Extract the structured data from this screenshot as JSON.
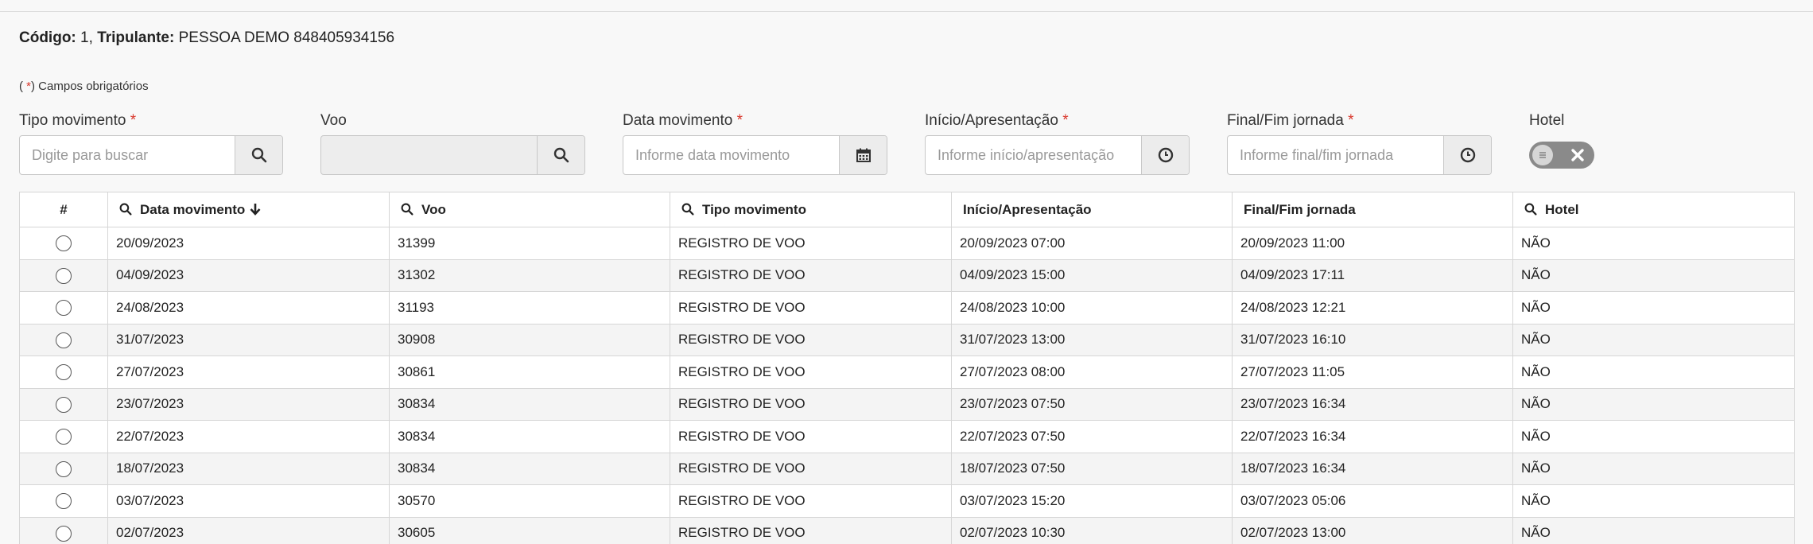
{
  "info": {
    "codigo_label": "Código:",
    "codigo_value": "1,",
    "tripulante_label": "Tripulante:",
    "tripulante_value": "PESSOA DEMO 848405934156"
  },
  "required_note": {
    "open": "(",
    "star": "*",
    "close": ") Campos obrigatórios"
  },
  "form": {
    "tipo_movimento": {
      "label": "Tipo movimento",
      "placeholder": "Digite para buscar",
      "required": "*",
      "button_icon": "search-icon"
    },
    "voo": {
      "label": "Voo",
      "placeholder": "",
      "button_icon": "search-icon"
    },
    "data_movimento": {
      "label": "Data movimento",
      "placeholder": "Informe data movimento",
      "required": "*",
      "button_icon": "calendar-icon"
    },
    "inicio": {
      "label": "Início/Apresentação",
      "placeholder": "Informe início/apresentação",
      "required": "*",
      "button_icon": "clock-icon"
    },
    "final": {
      "label": "Final/Fim jornada",
      "placeholder": "Informe final/fim jornada",
      "required": "*",
      "button_icon": "clock-icon"
    },
    "hotel": {
      "label": "Hotel",
      "state": "off"
    }
  },
  "table": {
    "headers": [
      "#",
      "Data movimento",
      "Voo",
      "Tipo movimento",
      "Início/Apresentação",
      "Final/Fim jornada",
      "Hotel"
    ],
    "rows": [
      [
        "20/09/2023",
        "31399",
        "REGISTRO DE VOO",
        "20/09/2023 07:00",
        "20/09/2023 11:00",
        "NÃO"
      ],
      [
        "04/09/2023",
        "31302",
        "REGISTRO DE VOO",
        "04/09/2023 15:00",
        "04/09/2023 17:11",
        "NÃO"
      ],
      [
        "24/08/2023",
        "31193",
        "REGISTRO DE VOO",
        "24/08/2023 10:00",
        "24/08/2023 12:21",
        "NÃO"
      ],
      [
        "31/07/2023",
        "30908",
        "REGISTRO DE VOO",
        "31/07/2023 13:00",
        "31/07/2023 16:10",
        "NÃO"
      ],
      [
        "27/07/2023",
        "30861",
        "REGISTRO DE VOO",
        "27/07/2023 08:00",
        "27/07/2023 11:05",
        "NÃO"
      ],
      [
        "23/07/2023",
        "30834",
        "REGISTRO DE VOO",
        "23/07/2023 07:50",
        "23/07/2023 16:34",
        "NÃO"
      ],
      [
        "22/07/2023",
        "30834",
        "REGISTRO DE VOO",
        "22/07/2023 07:50",
        "22/07/2023 16:34",
        "NÃO"
      ],
      [
        "18/07/2023",
        "30834",
        "REGISTRO DE VOO",
        "18/07/2023 07:50",
        "18/07/2023 16:34",
        "NÃO"
      ],
      [
        "03/07/2023",
        "30570",
        "REGISTRO DE VOO",
        "03/07/2023 15:20",
        "03/07/2023 05:06",
        "NÃO"
      ],
      [
        "02/07/2023",
        "30605",
        "REGISTRO DE VOO",
        "02/07/2023 10:30",
        "02/07/2023 13:00",
        "NÃO"
      ]
    ]
  }
}
